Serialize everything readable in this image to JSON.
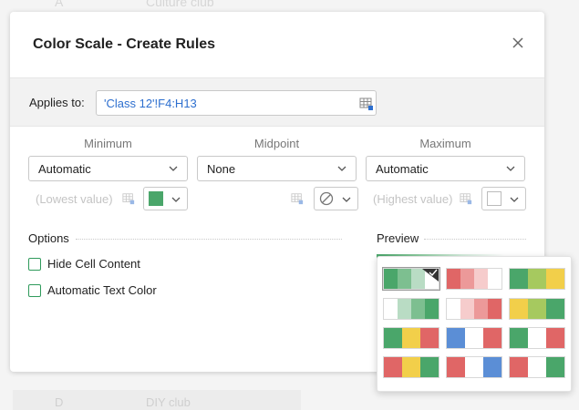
{
  "background": {
    "top_left_text": "A",
    "top_right_text": "Culture club",
    "bottom_left_text": "D",
    "bottom_right_text": "DIY club"
  },
  "dialog": {
    "title": "Color Scale - Create Rules",
    "close_icon": "close-icon"
  },
  "applies": {
    "label": "Applies to:",
    "value": "'Class 12'!F4:H13",
    "icon": "range-select-icon"
  },
  "columns": {
    "minimum": {
      "label": "Minimum",
      "type": "Automatic",
      "placeholder": "(Lowest value)",
      "color": "#4aa66a",
      "color_icon": "color-swatch"
    },
    "midpoint": {
      "label": "Midpoint",
      "type": "None",
      "placeholder": "",
      "color_icon": "no-color-icon"
    },
    "maximum": {
      "label": "Maximum",
      "type": "Automatic",
      "placeholder": "(Highest value)",
      "color": "#ffffff",
      "color_icon": "color-swatch"
    }
  },
  "options": {
    "label": "Options",
    "hide_cell_content": {
      "label": "Hide Cell Content",
      "checked": false
    },
    "automatic_text_color": {
      "label": "Automatic Text Color",
      "checked": false
    }
  },
  "preview": {
    "label": "Preview",
    "colors": [
      "#4aa66a",
      "#ffffff"
    ]
  },
  "palettes": [
    {
      "colors": [
        "#4aa66a",
        "#7dbf90",
        "#b9dcc4",
        "#ffffff"
      ],
      "selected": true
    },
    {
      "colors": [
        "#e06666",
        "#ec9999",
        "#f6cccc",
        "#ffffff"
      ],
      "selected": false
    },
    {
      "colors": [
        "#4aa66a",
        "#a6c95f",
        "#f2cf4a"
      ],
      "selected": false
    },
    {
      "colors": [
        "#ffffff",
        "#b9dcc4",
        "#7dbf90",
        "#4aa66a"
      ],
      "selected": false
    },
    {
      "colors": [
        "#ffffff",
        "#f6cccc",
        "#ec9999",
        "#e06666"
      ],
      "selected": false
    },
    {
      "colors": [
        "#f2cf4a",
        "#a6c95f",
        "#4aa66a"
      ],
      "selected": false
    },
    {
      "colors": [
        "#4aa66a",
        "#f2cf4a",
        "#e06666"
      ],
      "selected": false
    },
    {
      "colors": [
        "#5b8ed6",
        "#ffffff",
        "#e06666"
      ],
      "selected": false
    },
    {
      "colors": [
        "#4aa66a",
        "#ffffff",
        "#e06666"
      ],
      "selected": false
    },
    {
      "colors": [
        "#e06666",
        "#f2cf4a",
        "#4aa66a"
      ],
      "selected": false
    },
    {
      "colors": [
        "#e06666",
        "#ffffff",
        "#5b8ed6"
      ],
      "selected": false
    },
    {
      "colors": [
        "#e06666",
        "#ffffff",
        "#4aa66a"
      ],
      "selected": false
    }
  ]
}
